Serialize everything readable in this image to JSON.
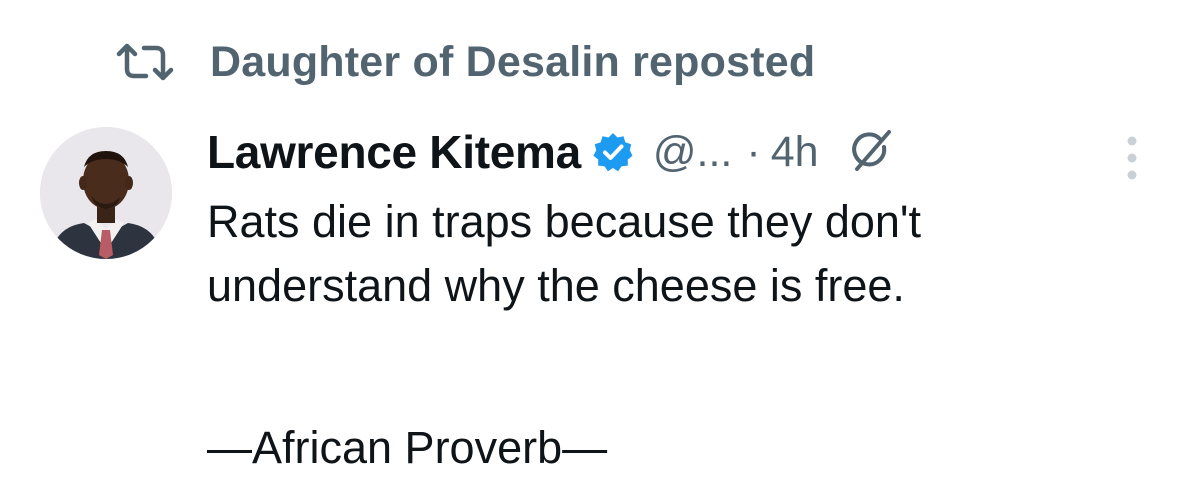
{
  "repost": {
    "icon": "repost-icon",
    "text": "Daughter of Desalin reposted"
  },
  "tweet": {
    "author": {
      "display_name": "Lawrence Kitema",
      "verified": true,
      "handle": "@...",
      "avatar_icon": "avatar"
    },
    "separator": "·",
    "time": "4h",
    "grok_icon": "grok-icon",
    "more_icon": "more-options-icon",
    "text_lines": [
      "Rats die in traps because they don't",
      "understand why the cheese is free."
    ],
    "attribution": "—African Proverb—"
  },
  "colors": {
    "text_primary": "#0f1419",
    "text_secondary": "#536471",
    "verified_blue": "#1d9bf0"
  }
}
